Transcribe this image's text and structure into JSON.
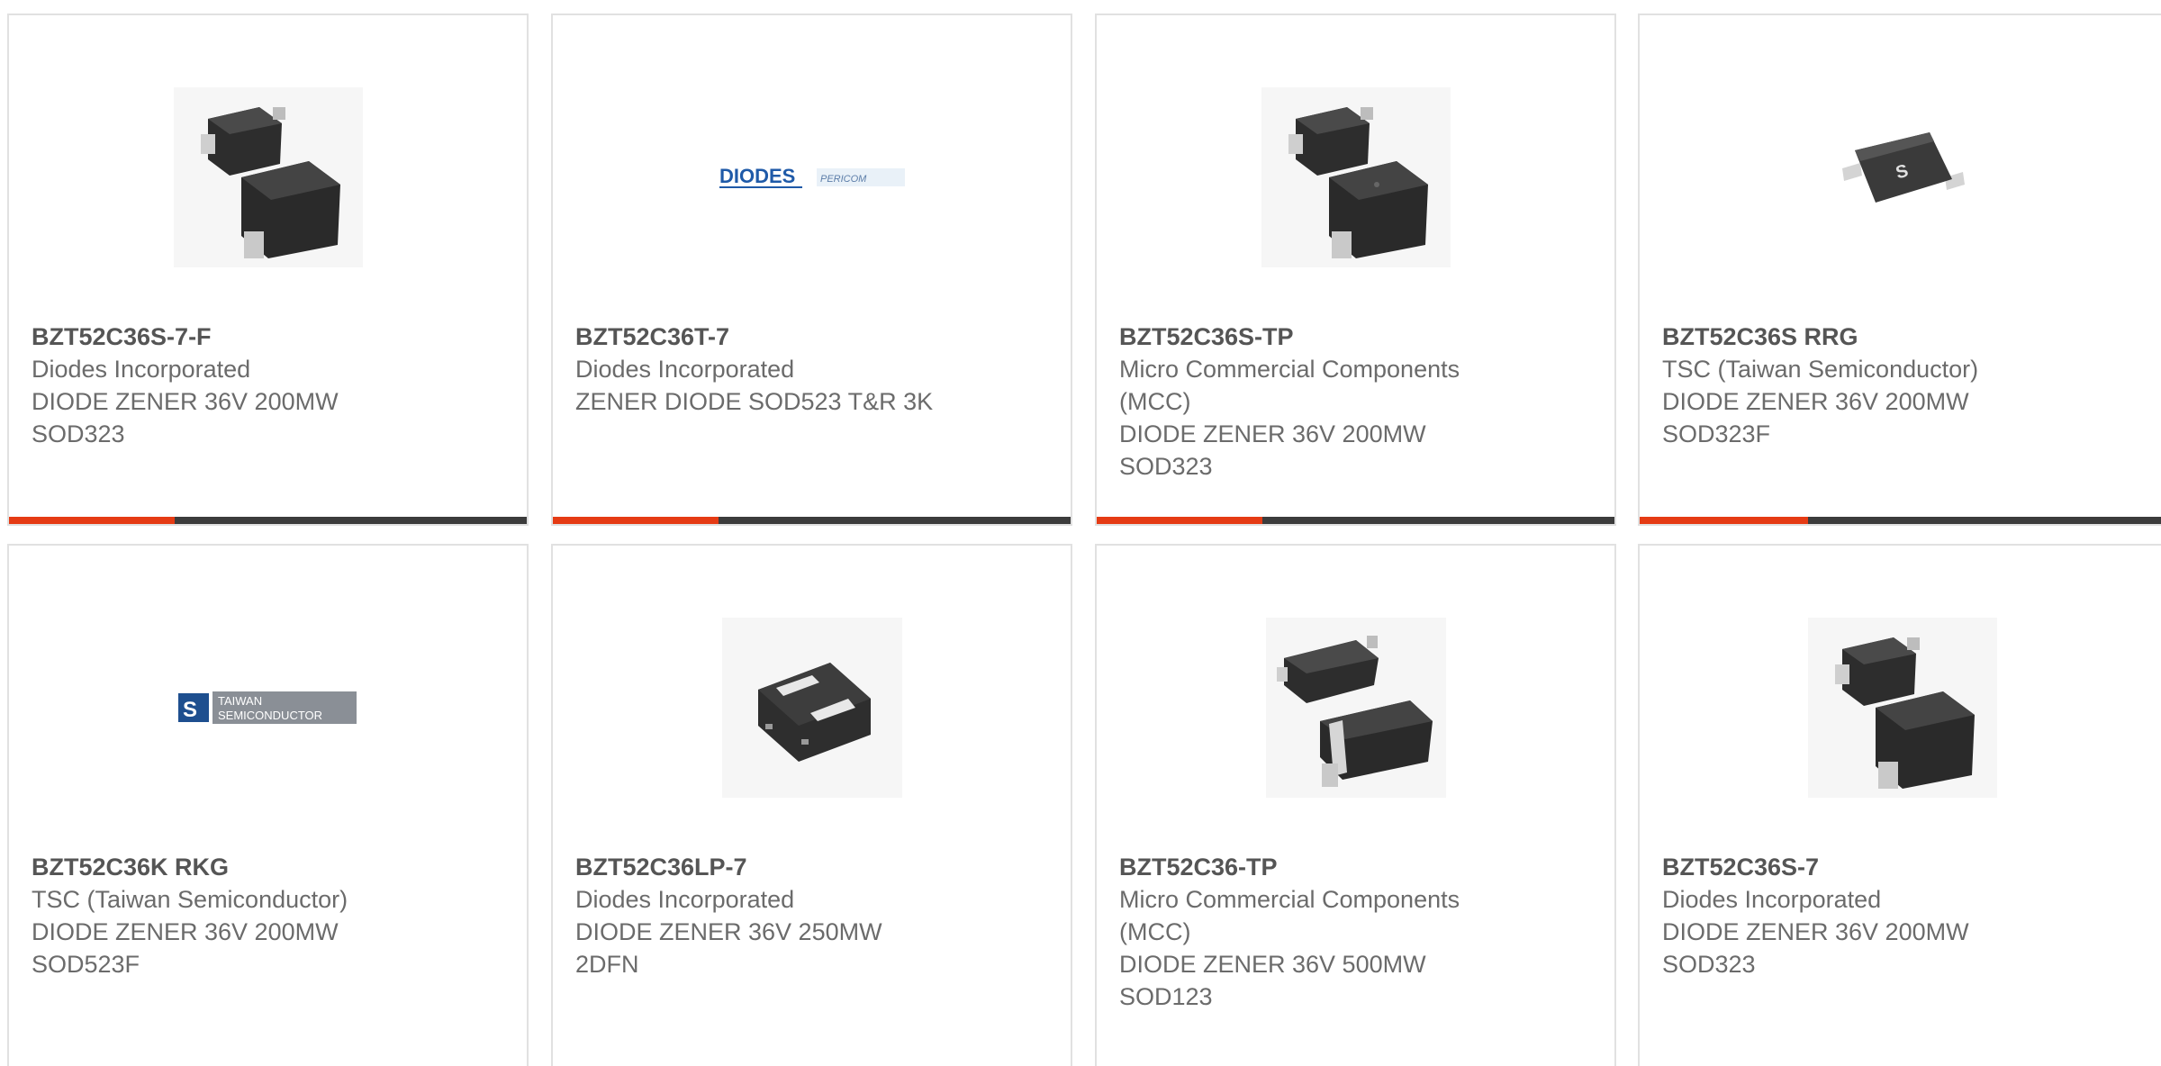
{
  "colors": {
    "accent": "#e53b14",
    "bar_track": "#3c3c3c",
    "text": "#6b6b6b"
  },
  "products": [
    {
      "part": "BZT52C36S-7-F",
      "manufacturer": "Diodes Incorporated",
      "desc_line1": "DIODE ZENER 36V 200MW",
      "desc_line2": "SOD323",
      "image": "sod323-package-photo",
      "progress_fraction": 0.32
    },
    {
      "part": "BZT52C36T-7",
      "manufacturer": "Diodes Incorporated",
      "desc_line1": "ZENER DIODE SOD523 T&R 3K",
      "desc_line2": "",
      "image": "diodes-pericom-logo",
      "logo_main": "DIODES",
      "logo_secondary": "PERICOM",
      "progress_fraction": 0.32
    },
    {
      "part": "BZT52C36S-TP",
      "manufacturer_line1": "Micro Commercial Components",
      "manufacturer_line2": "(MCC)",
      "desc_line1": "DIODE ZENER 36V 200MW",
      "desc_line2": "SOD323",
      "image": "sod323-package-photo",
      "progress_fraction": 0.32
    },
    {
      "part": "BZT52C36S RRG",
      "manufacturer": "TSC (Taiwan Semiconductor)",
      "desc_line1": "DIODE ZENER 36V 200MW",
      "desc_line2": "SOD323F",
      "image": "sod323f-package-photo",
      "progress_fraction": 0.32
    },
    {
      "part": "BZT52C36K RKG",
      "manufacturer": "TSC (Taiwan Semiconductor)",
      "desc_line1": "DIODE ZENER 36V 200MW",
      "desc_line2": "SOD523F",
      "image": "taiwan-semiconductor-logo",
      "logo_line1": "TAIWAN",
      "logo_line2": "SEMICONDUCTOR"
    },
    {
      "part": "BZT52C36LP-7",
      "manufacturer": "Diodes Incorporated",
      "desc_line1": "DIODE ZENER 36V 250MW",
      "desc_line2": "2DFN",
      "image": "dfn-package-photo"
    },
    {
      "part": "BZT52C36-TP",
      "manufacturer_line1": "Micro Commercial Components",
      "manufacturer_line2": "(MCC)",
      "desc_line1": "DIODE ZENER 36V 500MW",
      "desc_line2": "SOD123",
      "image": "sod123-package-photo"
    },
    {
      "part": "BZT52C36S-7",
      "manufacturer": "Diodes Incorporated",
      "desc_line1": "DIODE ZENER 36V 200MW",
      "desc_line2": "SOD323",
      "image": "sod323-package-photo"
    }
  ]
}
